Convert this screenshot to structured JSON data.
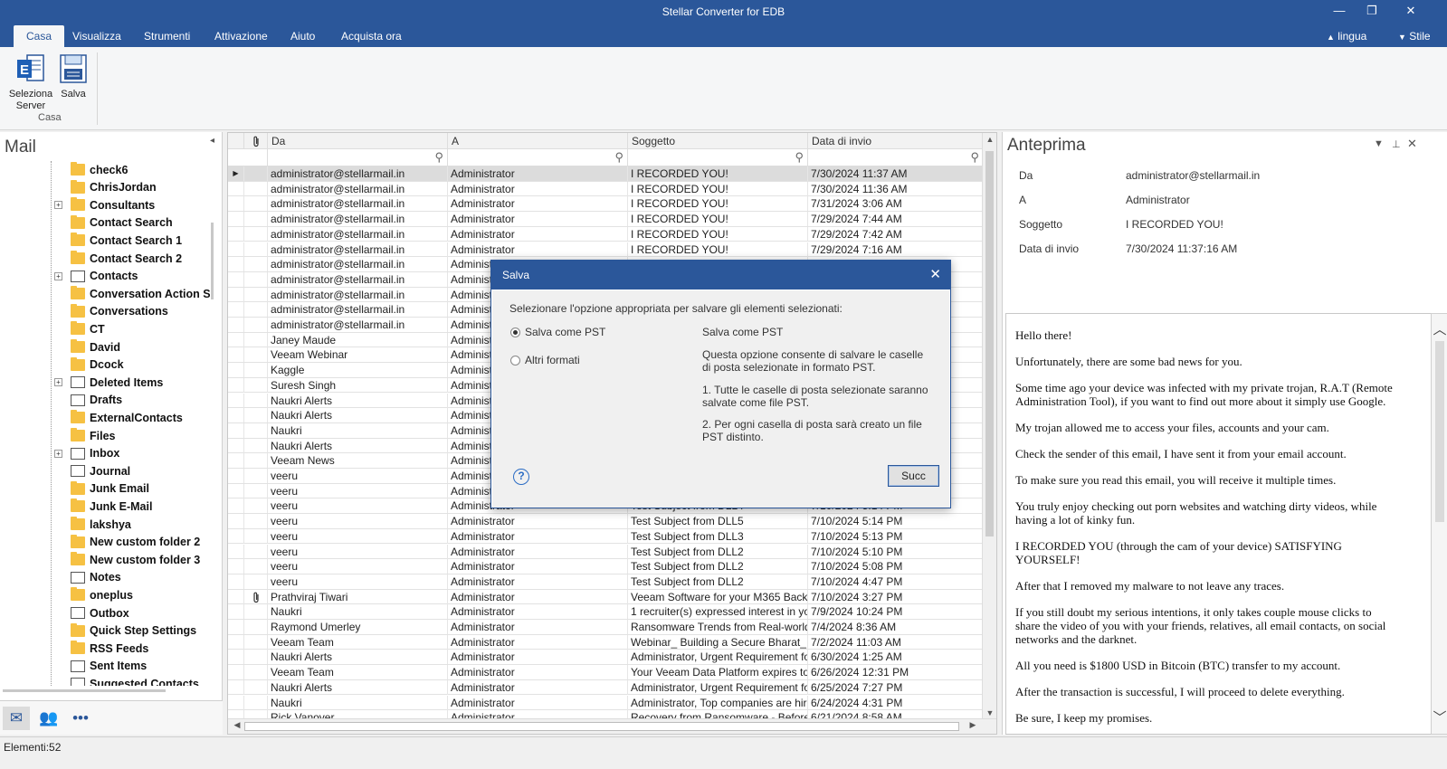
{
  "window": {
    "title": "Stellar Converter for EDB",
    "controls": [
      "—",
      "❐",
      "✕"
    ]
  },
  "ribbon": {
    "tabs": [
      "Casa",
      "Visualizza",
      "Strumenti",
      "Attivazione",
      "Aiuto",
      "Acquista ora"
    ],
    "active_tab": "Casa",
    "right_items": [
      "lingua",
      "Stile"
    ],
    "buttons": [
      {
        "label": "Seleziona Server",
        "icon": "exchange-server-icon"
      },
      {
        "label": "Salva",
        "icon": "save-icon"
      }
    ],
    "group_label": "Casa"
  },
  "mail_panel": {
    "title": "Mail",
    "folders": [
      {
        "name": "check6",
        "icon": "folder-icon",
        "expandable": false
      },
      {
        "name": "ChrisJordan",
        "icon": "folder-icon",
        "expandable": false
      },
      {
        "name": "Consultants",
        "icon": "folder-icon",
        "expandable": true
      },
      {
        "name": "Contact Search",
        "icon": "folder-icon",
        "expandable": false
      },
      {
        "name": "Contact Search 1",
        "icon": "folder-icon",
        "expandable": false
      },
      {
        "name": "Contact Search 2",
        "icon": "folder-icon",
        "expandable": false
      },
      {
        "name": "Contacts",
        "icon": "contacts-icon",
        "expandable": true
      },
      {
        "name": "Conversation Action Set",
        "icon": "folder-icon",
        "expandable": false
      },
      {
        "name": "Conversations",
        "icon": "folder-icon",
        "expandable": false
      },
      {
        "name": "CT",
        "icon": "folder-icon",
        "expandable": false
      },
      {
        "name": "David",
        "icon": "folder-icon",
        "expandable": false
      },
      {
        "name": "Dcock",
        "icon": "folder-icon",
        "expandable": false
      },
      {
        "name": "Deleted Items",
        "icon": "trash-icon",
        "expandable": true
      },
      {
        "name": "Drafts",
        "icon": "drafts-icon",
        "expandable": false
      },
      {
        "name": "ExternalContacts",
        "icon": "folder-icon",
        "expandable": false
      },
      {
        "name": "Files",
        "icon": "folder-icon",
        "expandable": false
      },
      {
        "name": "Inbox",
        "icon": "inbox-icon",
        "expandable": true
      },
      {
        "name": "Journal",
        "icon": "journal-icon",
        "expandable": false
      },
      {
        "name": "Junk Email",
        "icon": "folder-icon",
        "expandable": false
      },
      {
        "name": "Junk E-Mail",
        "icon": "folder-icon",
        "expandable": false
      },
      {
        "name": "lakshya",
        "icon": "folder-icon",
        "expandable": false
      },
      {
        "name": "New custom folder 2",
        "icon": "folder-icon",
        "expandable": false
      },
      {
        "name": "New custom folder 3",
        "icon": "folder-icon",
        "expandable": false
      },
      {
        "name": "Notes",
        "icon": "notes-icon",
        "expandable": false
      },
      {
        "name": "oneplus",
        "icon": "folder-icon",
        "expandable": false
      },
      {
        "name": "Outbox",
        "icon": "outbox-icon",
        "expandable": false
      },
      {
        "name": "Quick Step Settings",
        "icon": "folder-icon",
        "expandable": false
      },
      {
        "name": "RSS Feeds",
        "icon": "folder-icon",
        "expandable": false
      },
      {
        "name": "Sent Items",
        "icon": "sent-icon",
        "expandable": false
      },
      {
        "name": "Suggested Contacts",
        "icon": "contacts-icon",
        "expandable": false
      }
    ],
    "bottom_nav": [
      "mail-icon",
      "people-icon",
      "more-icon"
    ]
  },
  "grid": {
    "columns": [
      "Da",
      "A",
      "Soggetto",
      "Data di invio"
    ],
    "attachment_header_icon": "paperclip-icon",
    "rows": [
      {
        "from": "administrator@stellarmail.in",
        "to": "Administrator",
        "subject": "I RECORDED YOU!",
        "date": "7/30/2024 11:37 AM",
        "att": false,
        "selected": true
      },
      {
        "from": "administrator@stellarmail.in",
        "to": "Administrator",
        "subject": "I RECORDED YOU!",
        "date": "7/30/2024 11:36 AM",
        "att": false
      },
      {
        "from": "administrator@stellarmail.in",
        "to": "Administrator",
        "subject": "I RECORDED YOU!",
        "date": "7/31/2024 3:06 AM",
        "att": false
      },
      {
        "from": "administrator@stellarmail.in",
        "to": "Administrator",
        "subject": "I RECORDED YOU!",
        "date": "7/29/2024 7:44 AM",
        "att": false
      },
      {
        "from": "administrator@stellarmail.in",
        "to": "Administrator",
        "subject": "I RECORDED YOU!",
        "date": "7/29/2024 7:42 AM",
        "att": false
      },
      {
        "from": "administrator@stellarmail.in",
        "to": "Administrator",
        "subject": "I RECORDED YOU!",
        "date": "7/29/2024 7:16 AM",
        "att": false
      },
      {
        "from": "administrator@stellarmail.in",
        "to": "Administrator",
        "subject": "",
        "date": "",
        "att": false
      },
      {
        "from": "administrator@stellarmail.in",
        "to": "Administrator",
        "subject": "",
        "date": "",
        "att": false
      },
      {
        "from": "administrator@stellarmail.in",
        "to": "Administrator",
        "subject": "",
        "date": "",
        "att": false
      },
      {
        "from": "administrator@stellarmail.in",
        "to": "Administrator",
        "subject": "",
        "date": "",
        "att": false
      },
      {
        "from": "administrator@stellarmail.in",
        "to": "Administrator",
        "subject": "",
        "date": "",
        "att": false
      },
      {
        "from": "Janey Maude",
        "to": "Administrator",
        "subject": "",
        "date": "",
        "att": false
      },
      {
        "from": "Veeam Webinar",
        "to": "Administrator",
        "subject": "",
        "date": "",
        "att": false
      },
      {
        "from": "Kaggle",
        "to": "Administrator",
        "subject": "",
        "date": "",
        "att": false
      },
      {
        "from": "Suresh  Singh",
        "to": "Administrator",
        "subject": "",
        "date": "",
        "att": false
      },
      {
        "from": "Naukri Alerts",
        "to": "Administrator",
        "subject": "",
        "date": "",
        "att": false
      },
      {
        "from": "Naukri Alerts",
        "to": "Administrator",
        "subject": "",
        "date": "",
        "att": false
      },
      {
        "from": "Naukri",
        "to": "Administrator",
        "subject": "",
        "date": "",
        "att": false
      },
      {
        "from": "Naukri Alerts",
        "to": "Administrator",
        "subject": "",
        "date": "",
        "att": false
      },
      {
        "from": "Veeam News",
        "to": "Administrator",
        "subject": "",
        "date": "",
        "att": false
      },
      {
        "from": "veeru",
        "to": "Administrator",
        "subject": "",
        "date": "",
        "att": false
      },
      {
        "from": "veeru",
        "to": "Administrator",
        "subject": "",
        "date": "",
        "att": false
      },
      {
        "from": "veeru",
        "to": "Administrator",
        "subject": "Test Subject from DLL4",
        "date": "7/10/2024 5:14 PM",
        "att": false
      },
      {
        "from": "veeru",
        "to": "Administrator",
        "subject": "Test Subject from DLL5",
        "date": "7/10/2024 5:14 PM",
        "att": false
      },
      {
        "from": "veeru",
        "to": "Administrator",
        "subject": "Test Subject from DLL3",
        "date": "7/10/2024 5:13 PM",
        "att": false
      },
      {
        "from": "veeru",
        "to": "Administrator",
        "subject": "Test Subject from DLL2",
        "date": "7/10/2024 5:10 PM",
        "att": false
      },
      {
        "from": "veeru",
        "to": "Administrator",
        "subject": "Test Subject from DLL2",
        "date": "7/10/2024 5:08 PM",
        "att": false
      },
      {
        "from": "veeru",
        "to": "Administrator",
        "subject": "Test Subject from DLL2",
        "date": "7/10/2024 4:47 PM",
        "att": false
      },
      {
        "from": "Prathviraj Tiwari",
        "to": "Administrator",
        "subject": "Veeam Software for your M365 Backup...",
        "date": "7/10/2024 3:27 PM",
        "att": true
      },
      {
        "from": "Naukri",
        "to": "Administrator",
        "subject": "1 recruiter(s) expressed interest in your ...",
        "date": "7/9/2024 10:24 PM",
        "att": false
      },
      {
        "from": "Raymond Umerley",
        "to": "Administrator",
        "subject": "Ransomware Trends from Real-world R...",
        "date": "7/4/2024 8:36 AM",
        "att": false
      },
      {
        "from": "Veeam Team",
        "to": "Administrator",
        "subject": "Webinar_ Building a Secure Bharat_ R...",
        "date": "7/2/2024 11:03 AM",
        "att": false
      },
      {
        "from": "Naukri Alerts",
        "to": "Administrator",
        "subject": "Administrator, Urgent Requirement for t...",
        "date": "6/30/2024 1:25 AM",
        "att": false
      },
      {
        "from": "Veeam Team",
        "to": "Administrator",
        "subject": "Your Veeam Data Platform expires today",
        "date": "6/26/2024 12:31 PM",
        "att": false
      },
      {
        "from": "Naukri Alerts",
        "to": "Administrator",
        "subject": "Administrator, Urgent Requirement for t...",
        "date": "6/25/2024 7:27 PM",
        "att": false
      },
      {
        "from": "Naukri",
        "to": "Administrator",
        "subject": "Administrator, Top companies are hiring...",
        "date": "6/24/2024 4:31 PM",
        "att": false
      },
      {
        "from": "Rick Vanover",
        "to": "Administrator",
        "subject": "Recovery from Ransomware - Before...",
        "date": "6/21/2024 8:58 AM",
        "att": false
      }
    ]
  },
  "preview": {
    "title": "Anteprima",
    "fields": [
      {
        "label": "Da",
        "value": "administrator@stellarmail.in"
      },
      {
        "label": "A",
        "value": "Administrator"
      },
      {
        "label": "Soggetto",
        "value": "I RECORDED YOU!"
      },
      {
        "label": "Data di invio",
        "value": "7/30/2024 11:37:16 AM"
      }
    ],
    "body": [
      "Hello there!",
      "Unfortunately, there are some bad news for you.",
      "Some time ago your device was infected with my private trojan, R.A.T (Remote Administration Tool), if you want to find out more about it simply use Google.",
      "My trojan allowed me to access your files, accounts and your cam.",
      "Check the sender of this email, I have sent it from your email account.",
      "To make sure you read this email, you will receive it multiple times.",
      "You truly enjoy checking out porn websites and watching dirty videos, while having a lot of kinky fun.",
      "I RECORDED YOU (through the cam of your device) SATISFYING YOURSELF!",
      "After that I removed my malware to not leave any traces.",
      "If you still doubt my serious intentions, it only takes couple mouse clicks to share the video of you with your friends, relatives, all email contacts, on social networks and the darknet.",
      "All you need is $1800 USD in Bitcoin (BTC) transfer to my account.",
      "After the transaction is successful, I will proceed to delete everything.",
      "Be sure, I keep my promises."
    ]
  },
  "status": {
    "text": "Elementi:52"
  },
  "dialog": {
    "title": "Salva",
    "prompt": "Selezionare l'opzione appropriata per salvare gli elementi selezionati:",
    "options": [
      {
        "label": "Salva come PST",
        "selected": true
      },
      {
        "label": "Altri formati",
        "selected": false
      }
    ],
    "desc_title": "Salva come PST",
    "desc_lines": [
      "Questa opzione consente di salvare le caselle di posta selezionate in formato PST.",
      "1. Tutte le caselle di posta selezionate saranno salvate come file PST.",
      "2. Per ogni casella di posta sarà creato un file PST distinto."
    ],
    "button": "Succ",
    "help_label": "?"
  }
}
